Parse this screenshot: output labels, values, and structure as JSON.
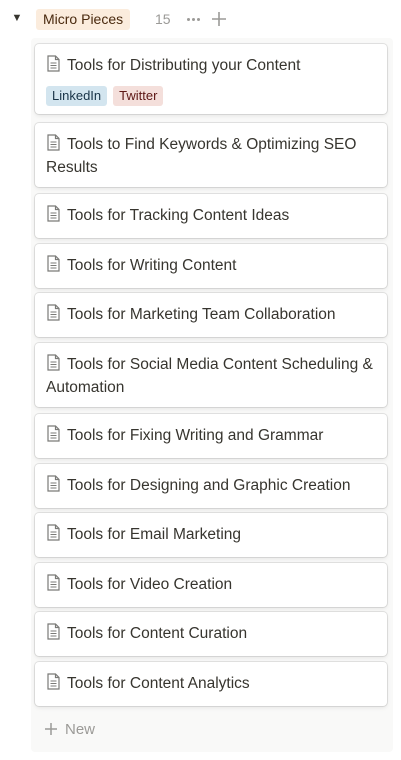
{
  "group": {
    "label": "Micro Pieces",
    "count": "15",
    "pill_bg": "#fbecdd",
    "pill_text": "#49290e"
  },
  "icons": {
    "toggle": "triangle-down-icon",
    "more": "ellipsis-icon",
    "add": "plus-icon",
    "page": "page-icon"
  },
  "cards": [
    {
      "title": "Tools for Distributing your Content",
      "tags": [
        {
          "label": "LinkedIn",
          "bg": "#d3e5ef",
          "fg": "#183347"
        },
        {
          "label": "Twitter",
          "bg": "#f4dfdb",
          "fg": "#5d1715"
        }
      ]
    },
    {
      "title": "Tools to Find Keywords & Optimizing SEO Results"
    },
    {
      "title": "Tools for Tracking Content Ideas"
    },
    {
      "title": "Tools for Writing Content"
    },
    {
      "title": "Tools for Marketing Team Collaboration"
    },
    {
      "title": "Tools for Social Media Content Scheduling & Automation"
    },
    {
      "title": "Tools for Fixing Writing and Grammar"
    },
    {
      "title": "Tools for Designing and Graphic Creation"
    },
    {
      "title": "Tools for Email Marketing"
    },
    {
      "title": "Tools for Video Creation"
    },
    {
      "title": "Tools for Content Curation"
    },
    {
      "title": "Tools for Content Analytics"
    }
  ],
  "new_label": "New"
}
